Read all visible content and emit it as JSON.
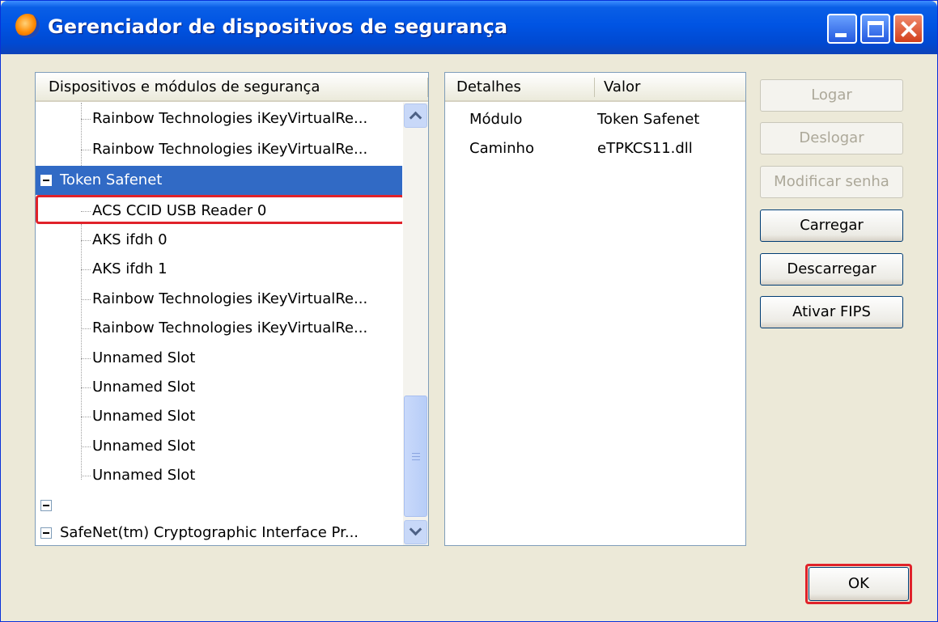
{
  "window": {
    "title": "Gerenciador de dispositivos de segurança",
    "controls": [
      "minimize-icon",
      "maximize-icon",
      "close-icon"
    ]
  },
  "tree": {
    "header": "Dispositivos e módulos de segurança",
    "rows": [
      {
        "label": "Rainbow Technologies iKeyVirtualRe...",
        "kind": "child"
      },
      {
        "label": "Rainbow Technologies iKeyVirtualRe...",
        "kind": "child"
      },
      {
        "label": "Token Safenet",
        "kind": "module",
        "expanded": true,
        "selected": true
      },
      {
        "label": "ACS CCID USB Reader 0",
        "kind": "child"
      },
      {
        "label": "AKS ifdh 0",
        "kind": "child"
      },
      {
        "label": "AKS ifdh 1",
        "kind": "child"
      },
      {
        "label": "Rainbow Technologies iKeyVirtualRe...",
        "kind": "child"
      },
      {
        "label": "Rainbow Technologies iKeyVirtualRe...",
        "kind": "child"
      },
      {
        "label": "Unnamed Slot",
        "kind": "child"
      },
      {
        "label": "Unnamed Slot",
        "kind": "child"
      },
      {
        "label": "Unnamed Slot",
        "kind": "child"
      },
      {
        "label": "Unnamed Slot",
        "kind": "child"
      },
      {
        "label": "Unnamed Slot",
        "kind": "child"
      },
      {
        "label": "",
        "kind": "module",
        "expanded": true
      },
      {
        "label": "SafeNet(tm) Cryptographic Interface Pr...",
        "kind": "module",
        "expanded": true
      }
    ]
  },
  "details": {
    "columns": [
      "Detalhes",
      "Valor"
    ],
    "rows": [
      {
        "key": "Módulo",
        "value": "Token Safenet"
      },
      {
        "key": "Caminho",
        "value": "eTPKCS11.dll"
      }
    ]
  },
  "buttons": {
    "login": "Logar",
    "logout": "Deslogar",
    "change_password": "Modificar senha",
    "load": "Carregar",
    "unload": "Descarregar",
    "enable_fips": "Ativar FIPS",
    "ok": "OK"
  },
  "colors": {
    "selection": "#316ac5",
    "highlight_outline": "#e0222a",
    "titlebar": "#0054e3"
  }
}
